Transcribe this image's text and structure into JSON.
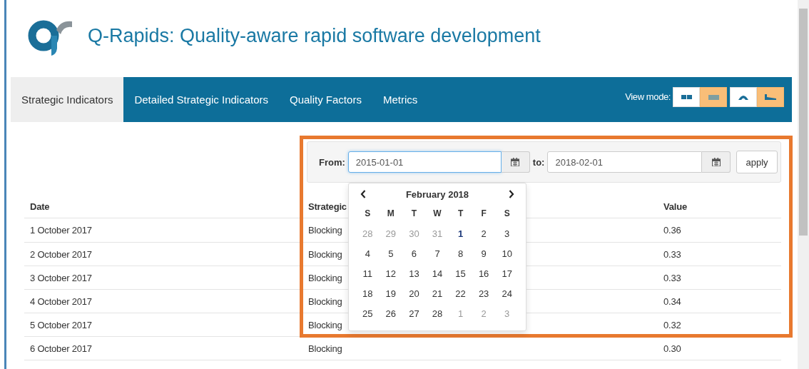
{
  "header": {
    "title": "Q-Rapids: Quality-aware rapid software development"
  },
  "nav": {
    "tabs": [
      {
        "label": "Strategic Indicators",
        "selected": true
      },
      {
        "label": "Detailed Strategic Indicators",
        "selected": false
      },
      {
        "label": "Quality Factors",
        "selected": false
      },
      {
        "label": "Metrics",
        "selected": false
      }
    ],
    "view_mode": {
      "label": "View mode:",
      "buttons": [
        {
          "kind": "grid",
          "selected": false
        },
        {
          "kind": "table",
          "selected": true
        },
        {
          "kind": "gauge",
          "selected": false
        },
        {
          "kind": "chart",
          "selected": true
        }
      ]
    }
  },
  "filter": {
    "from_label": "From:",
    "from_value": "2015-01-01",
    "from_focused": true,
    "to_label": "to:",
    "to_value": "2018-02-01",
    "to_focused": false,
    "apply": "apply"
  },
  "datepicker": {
    "month": "February 2018",
    "weekdays": [
      "S",
      "M",
      "T",
      "W",
      "T",
      "F",
      "S"
    ],
    "weeks": [
      [
        {
          "day": "28",
          "other_month": true,
          "highlighted": false
        },
        {
          "day": "29",
          "other_month": true,
          "highlighted": false
        },
        {
          "day": "30",
          "other_month": true,
          "highlighted": false
        },
        {
          "day": "31",
          "other_month": true,
          "highlighted": false
        },
        {
          "day": "1",
          "other_month": false,
          "highlighted": true
        },
        {
          "day": "2",
          "other_month": false,
          "highlighted": false
        },
        {
          "day": "3",
          "other_month": false,
          "highlighted": false
        }
      ],
      [
        {
          "day": "4",
          "other_month": false,
          "highlighted": false
        },
        {
          "day": "5",
          "other_month": false,
          "highlighted": false
        },
        {
          "day": "6",
          "other_month": false,
          "highlighted": false
        },
        {
          "day": "7",
          "other_month": false,
          "highlighted": false
        },
        {
          "day": "8",
          "other_month": false,
          "highlighted": false
        },
        {
          "day": "9",
          "other_month": false,
          "highlighted": false
        },
        {
          "day": "10",
          "other_month": false,
          "highlighted": false
        }
      ],
      [
        {
          "day": "11",
          "other_month": false,
          "highlighted": false
        },
        {
          "day": "12",
          "other_month": false,
          "highlighted": false
        },
        {
          "day": "13",
          "other_month": false,
          "highlighted": false
        },
        {
          "day": "14",
          "other_month": false,
          "highlighted": false
        },
        {
          "day": "15",
          "other_month": false,
          "highlighted": false
        },
        {
          "day": "16",
          "other_month": false,
          "highlighted": false
        },
        {
          "day": "17",
          "other_month": false,
          "highlighted": false
        }
      ],
      [
        {
          "day": "18",
          "other_month": false,
          "highlighted": false
        },
        {
          "day": "19",
          "other_month": false,
          "highlighted": false
        },
        {
          "day": "20",
          "other_month": false,
          "highlighted": false
        },
        {
          "day": "21",
          "other_month": false,
          "highlighted": false
        },
        {
          "day": "22",
          "other_month": false,
          "highlighted": false
        },
        {
          "day": "23",
          "other_month": false,
          "highlighted": false
        },
        {
          "day": "24",
          "other_month": false,
          "highlighted": false
        }
      ],
      [
        {
          "day": "25",
          "other_month": false,
          "highlighted": false
        },
        {
          "day": "26",
          "other_month": false,
          "highlighted": false
        },
        {
          "day": "27",
          "other_month": false,
          "highlighted": false
        },
        {
          "day": "28",
          "other_month": false,
          "highlighted": false
        },
        {
          "day": "1",
          "other_month": true,
          "highlighted": false
        },
        {
          "day": "2",
          "other_month": true,
          "highlighted": false
        },
        {
          "day": "3",
          "other_month": true,
          "highlighted": false
        }
      ]
    ]
  },
  "table": {
    "columns": [
      "Date",
      "Strategic",
      "Value"
    ],
    "rows": [
      [
        "1 October 2017",
        "Blocking",
        "0.36"
      ],
      [
        "2 October 2017",
        "Blocking",
        "0.33"
      ],
      [
        "3 October 2017",
        "Blocking",
        "0.33"
      ],
      [
        "4 October 2017",
        "Blocking",
        "0.34"
      ],
      [
        "5 October 2017",
        "Blocking",
        "0.32"
      ],
      [
        "6 October 2017",
        "Blocking",
        "0.30"
      ]
    ]
  }
}
